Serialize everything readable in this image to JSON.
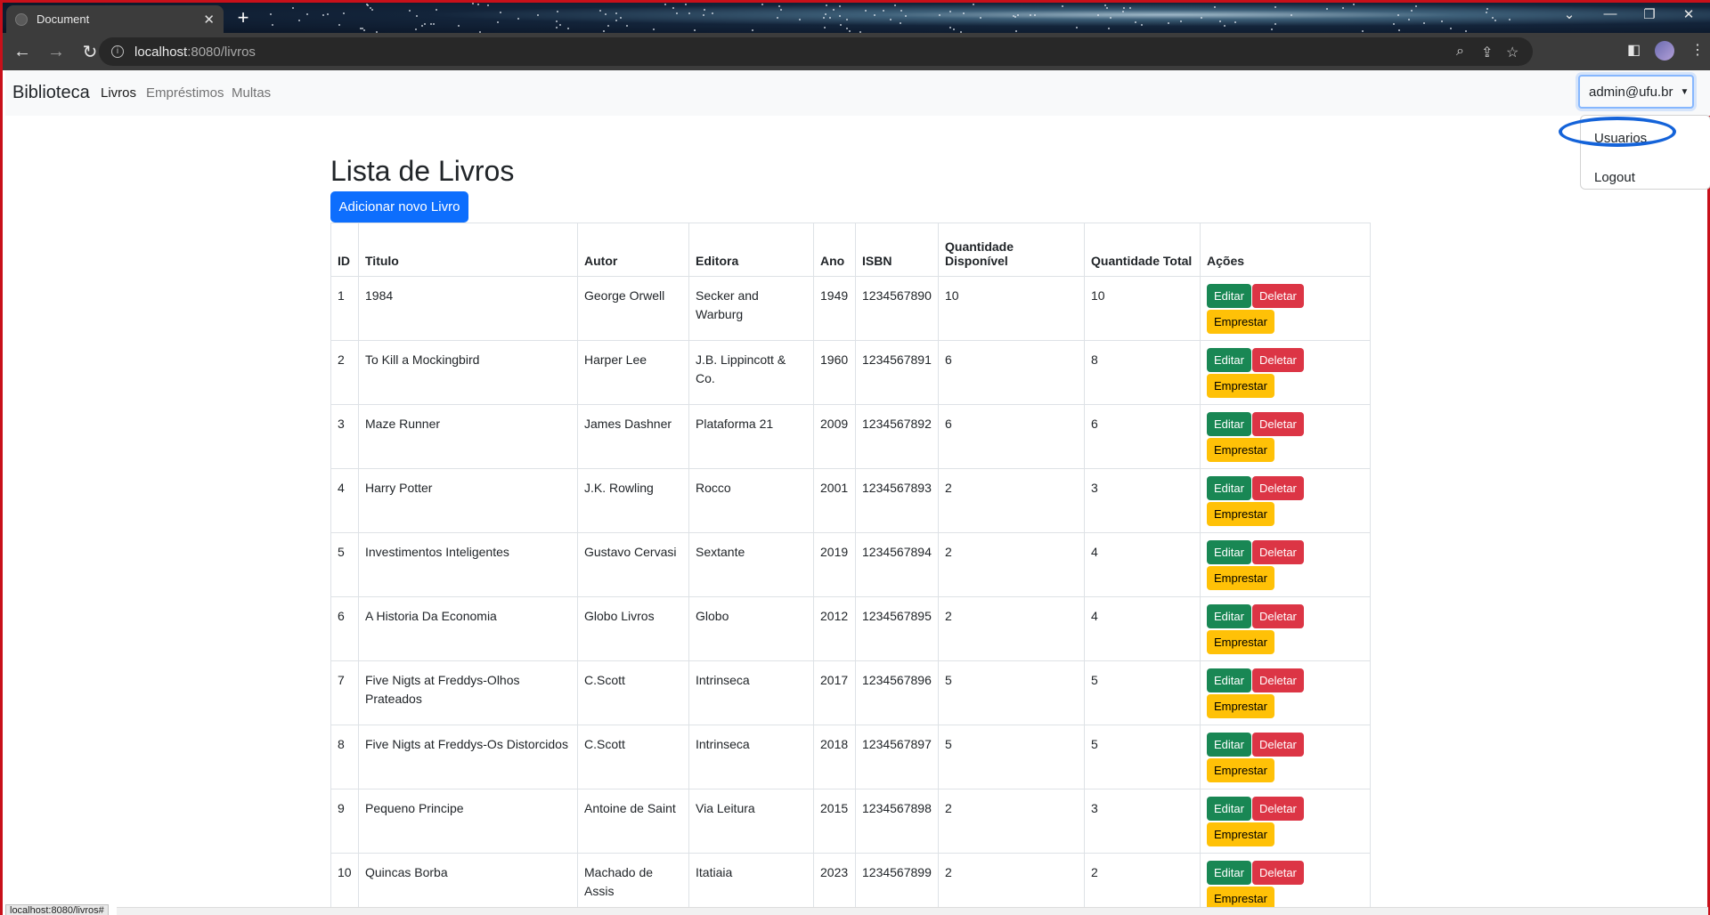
{
  "browser": {
    "tab_title": "Document",
    "url_host": "localhost",
    "url_path": ":8080/livros",
    "status_url": "localhost:8080/livros#"
  },
  "navbar": {
    "brand": "Biblioteca",
    "links": [
      "Livros",
      "Empréstimos",
      "Multas"
    ],
    "user": "admin@ufu.br",
    "dropdown": [
      "Usuarios",
      "Logout"
    ]
  },
  "main": {
    "title": "Lista de Livros",
    "add_button": "Adicionar novo Livro",
    "columns": [
      "ID",
      "Titulo",
      "Autor",
      "Editora",
      "Ano",
      "ISBN",
      "Quantidade Disponível",
      "Quantidade Total",
      "Ações"
    ],
    "action_labels": {
      "edit": "Editar",
      "delete": "Deletar",
      "lend": "Emprestar"
    },
    "rows": [
      [
        "1",
        "1984",
        "George Orwell",
        "Secker and Warburg",
        "1949",
        "1234567890",
        "10",
        "10"
      ],
      [
        "2",
        "To Kill a Mockingbird",
        "Harper Lee",
        "J.B. Lippincott & Co.",
        "1960",
        "1234567891",
        "6",
        "8"
      ],
      [
        "3",
        "Maze Runner",
        "James Dashner",
        "Plataforma 21",
        "2009",
        "1234567892",
        "6",
        "6"
      ],
      [
        "4",
        "Harry Potter",
        "J.K. Rowling",
        "Rocco",
        "2001",
        "1234567893",
        "2",
        "3"
      ],
      [
        "5",
        "Investimentos Inteligentes",
        "Gustavo Cervasi",
        "Sextante",
        "2019",
        "1234567894",
        "2",
        "4"
      ],
      [
        "6",
        "A Historia Da Economia",
        "Globo Livros",
        "Globo",
        "2012",
        "1234567895",
        "2",
        "4"
      ],
      [
        "7",
        "Five Nigts at Freddys-Olhos Prateados",
        "C.Scott",
        "Intrinseca",
        "2017",
        "1234567896",
        "5",
        "5"
      ],
      [
        "8",
        "Five Nigts at Freddys-Os Distorcidos",
        "C.Scott",
        "Intrinseca",
        "2018",
        "1234567897",
        "5",
        "5"
      ],
      [
        "9",
        "Pequeno Principe",
        "Antoine de Saint",
        "Via Leitura",
        "2015",
        "1234567898",
        "2",
        "3"
      ],
      [
        "10",
        "Quincas Borba",
        "Machado de Assis",
        "Itatiaia",
        "2023",
        "1234567899",
        "2",
        "2"
      ]
    ]
  }
}
